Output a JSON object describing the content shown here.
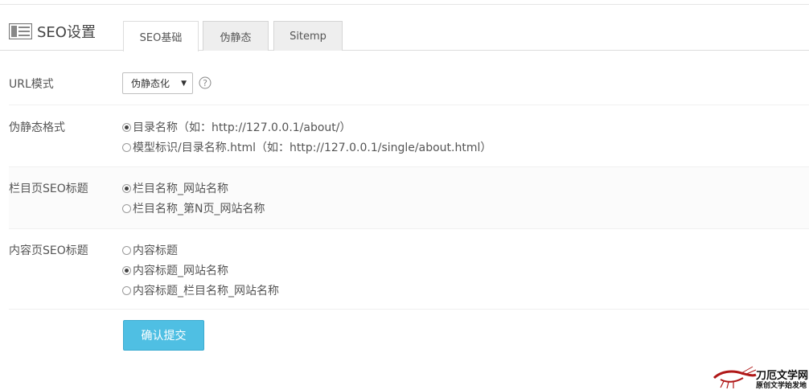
{
  "header": {
    "title": "SEO设置",
    "icon": "newspaper-icon",
    "tabs": [
      {
        "label": "SEO基础",
        "active": true
      },
      {
        "label": "伪静态",
        "active": false
      },
      {
        "label": "Sitemp",
        "active": false
      }
    ]
  },
  "form": {
    "url_mode": {
      "label": "URL模式",
      "selected": "伪静态化",
      "help_icon": "question-circle-icon"
    },
    "static_format": {
      "label": "伪静态格式",
      "options": [
        {
          "text": "目录名称（如：http://127.0.0.1/about/）",
          "checked": true
        },
        {
          "text": "模型标识/目录名称.html（如：http://127.0.0.1/single/about.html）",
          "checked": false
        }
      ]
    },
    "column_seo_title": {
      "label": "栏目页SEO标题",
      "options": [
        {
          "text": "栏目名称_网站名称",
          "checked": true
        },
        {
          "text": "栏目名称_第N页_网站名称",
          "checked": false
        }
      ]
    },
    "content_seo_title": {
      "label": "内容页SEO标题",
      "options": [
        {
          "text": "内容标题",
          "checked": false
        },
        {
          "text": "内容标题_网站名称",
          "checked": true
        },
        {
          "text": "内容标题_栏目名称_网站名称",
          "checked": false
        }
      ]
    },
    "submit_label": "确认提交"
  },
  "watermark": {
    "line1": "刀厄文学网",
    "line2": "原创文学始发地"
  },
  "colors": {
    "accent": "#4fbfe3",
    "border": "#dddddd",
    "text": "#555555"
  }
}
